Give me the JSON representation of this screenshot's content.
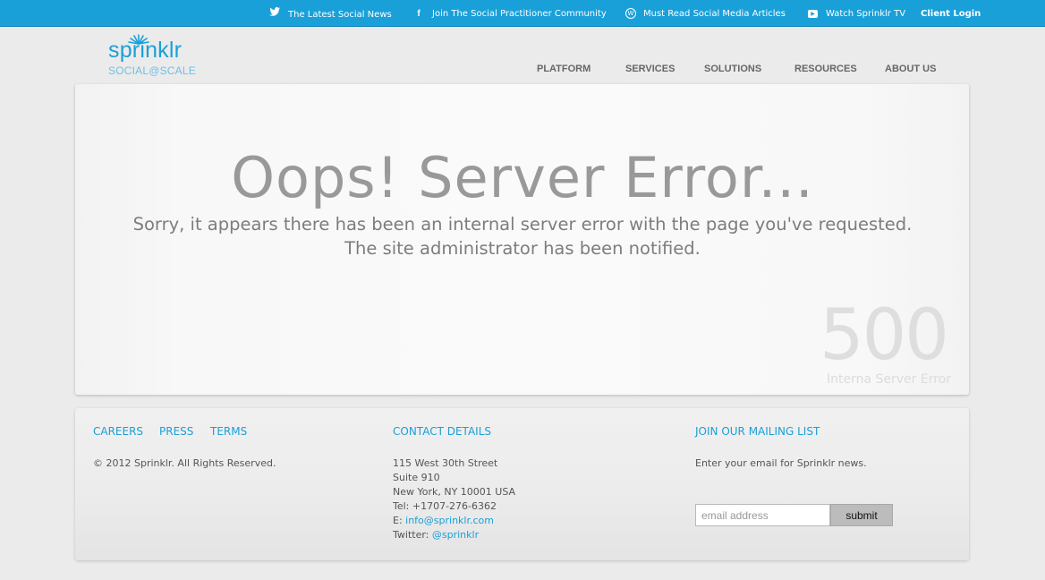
{
  "topbar": {
    "links": [
      {
        "label": "The Latest Social News",
        "icon": "twitter-icon"
      },
      {
        "label": "Join The Social Practitioner Community",
        "icon": "facebook-icon"
      },
      {
        "label": "Must Read Social Media Articles",
        "icon": "wordpress-icon"
      },
      {
        "label": "Watch Sprinklr TV",
        "icon": "youtube-icon"
      }
    ],
    "client_login": "Client Login"
  },
  "logo": {
    "wordmark": "sprinklr",
    "tagline": "SOCIAL@SCALE"
  },
  "nav": [
    "PLATFORM",
    "SERVICES",
    "SOLUTIONS",
    "RESOURCES",
    "ABOUT US"
  ],
  "error": {
    "title": "Oops! Server Error...",
    "line1": "Sorry, it appears there has been an internal server error with the page you've requested.",
    "line2": "The site administrator has been notified.",
    "code": "500",
    "code_caption": "Interna Server Error"
  },
  "footer": {
    "links": [
      "CAREERS",
      "PRESS",
      "TERMS"
    ],
    "copyright": "© 2012 Sprinklr. All Rights Reserved.",
    "contact": {
      "heading": "CONTACT DETAILS",
      "address1": "115 West 30th Street",
      "address2": "Suite 910",
      "address3": "New York, NY 10001 USA",
      "tel": "Tel: +1707-276-6362",
      "email_prefix": "E: ",
      "email": "info@sprinklr.com",
      "twitter_prefix": "Twitter: ",
      "twitter": "@sprinklr"
    },
    "mailing": {
      "heading": "JOIN OUR MAILING LIST",
      "text": "Enter your email for Sprinklr news.",
      "placeholder": "email address",
      "submit": "submit"
    }
  },
  "colors": {
    "topbar": "#1aa0d8",
    "accent": "#1a9fd6",
    "error_text": "#999999"
  }
}
